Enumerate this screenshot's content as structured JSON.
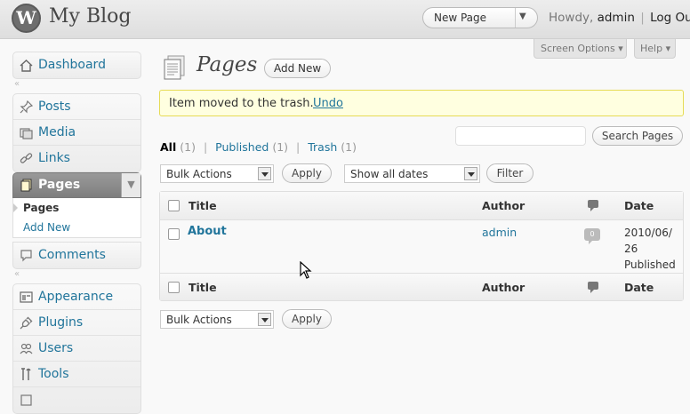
{
  "header": {
    "site_title": "My Blog",
    "favorite_action": "New Page",
    "howdy": "Howdy, ",
    "user": "admin",
    "separator": "|",
    "logout": "Log Out"
  },
  "screen_meta": {
    "screen_options": "Screen Options ▾",
    "help": "Help ▾"
  },
  "menu": {
    "dashboard": "Dashboard",
    "separator": "«",
    "posts": "Posts",
    "media": "Media",
    "links": "Links",
    "pages": "Pages",
    "pages_sub": [
      "Pages",
      "Add New"
    ],
    "comments": "Comments",
    "appearance": "Appearance",
    "plugins": "Plugins",
    "users": "Users",
    "tools": "Tools"
  },
  "main": {
    "title": "Pages",
    "add_new": "Add New",
    "message": "Item moved to the trash.",
    "undo": "Undo",
    "filters": {
      "all": "All",
      "all_count": "(1)",
      "published": "Published",
      "published_count": "(1)",
      "trash": "Trash",
      "trash_count": "(1)",
      "sep": "|"
    },
    "search_button": "Search Pages",
    "search_value": "",
    "bulk_actions": "Bulk Actions",
    "apply": "Apply",
    "dates": "Show all dates",
    "filter": "Filter"
  },
  "table": {
    "columns": {
      "title": "Title",
      "author": "Author",
      "date": "Date"
    },
    "rows": [
      {
        "title": "About",
        "author": "admin",
        "comments": "0",
        "date_line1": "2010/06/",
        "date_line2": "26",
        "status": "Published"
      }
    ]
  }
}
